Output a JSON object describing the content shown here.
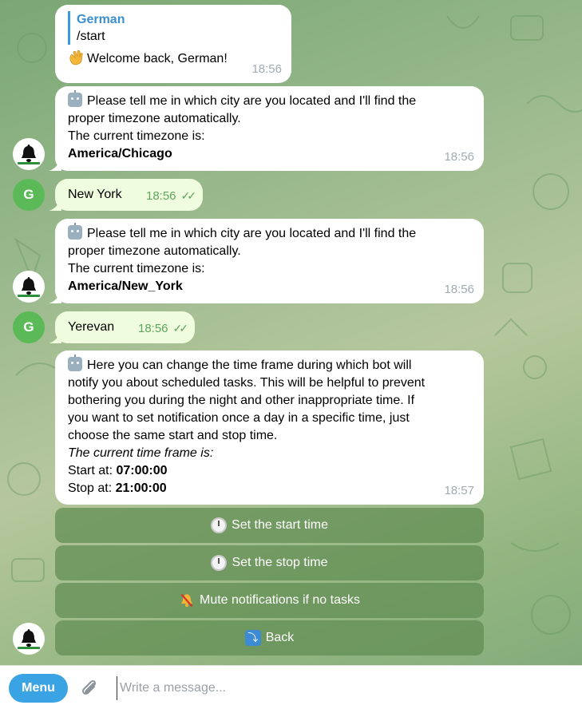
{
  "messages": {
    "m1": {
      "reply_name": "German",
      "reply_text": "/start",
      "text": "Welcome back, German!",
      "time": "18:56"
    },
    "m2": {
      "line1": "Please tell me in which city are you located and I'll find the",
      "line2": "proper timezone automatically.",
      "line3": "The current timezone is:",
      "tz": "America/Chicago",
      "time": "18:56"
    },
    "m3": {
      "text": "New York",
      "time": "18:56"
    },
    "m4": {
      "line1": "Please tell me in which city are you located and I'll find the",
      "line2": "proper timezone automatically.",
      "line3": "The current timezone is:",
      "tz": "America/New_York",
      "time": "18:56"
    },
    "m5": {
      "text": "Yerevan",
      "time": "18:56"
    },
    "m6": {
      "line1": "Here you can change the time frame during which bot will",
      "line2": "notify you about scheduled tasks. This will be helpful to prevent",
      "line3": "bothering you during the night and other inappropriate time. If",
      "line4": "you want to set notification once a day in a specific time, just",
      "line5": "choose the same start and stop time.",
      "frame_label": "The current time frame is:",
      "start_label": "Start at:",
      "start_value": "07:00:00",
      "stop_label": "Stop at:",
      "stop_value": "21:00:00",
      "time": "18:57"
    }
  },
  "user_avatar_letter": "G",
  "keyboard": {
    "set_start": "Set the start time",
    "set_stop": "Set the stop time",
    "mute": "Mute notifications if no tasks",
    "back": "Back"
  },
  "composer": {
    "menu_label": "Menu",
    "placeholder": "Write a message..."
  },
  "colors": {
    "accent": "#3aa3e3",
    "outgoing_bubble": "#effdde",
    "read_ticks": "#5fa560",
    "user_avatar": "#5bba57"
  }
}
